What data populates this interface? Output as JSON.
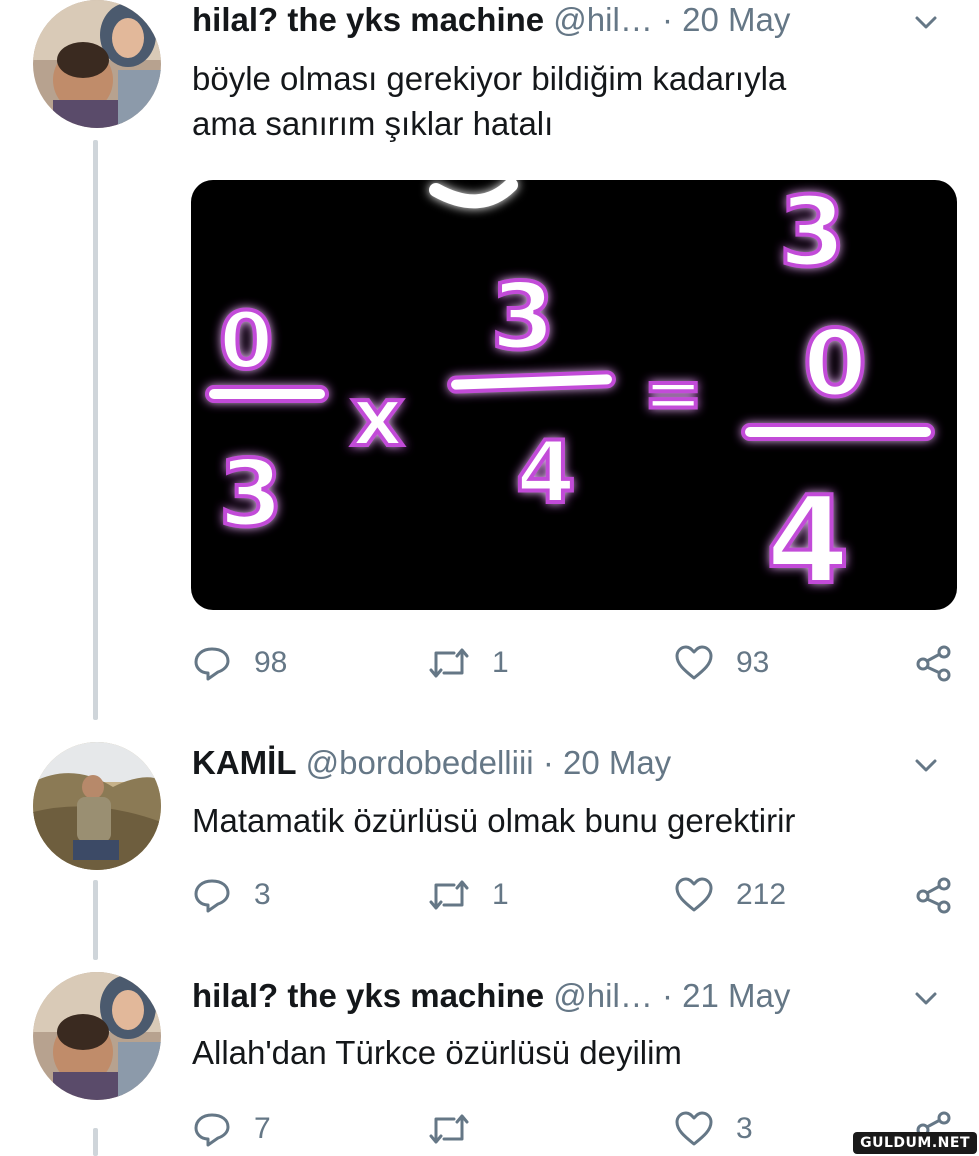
{
  "tweets": [
    {
      "display_name": "hilal? the yks machine",
      "handle": "@hil…",
      "date": "· 20 May",
      "text_lines": [
        "böyle olması gerekiyor bildiğim kadarıyla",
        "ama sanırım şıklar hatalı"
      ],
      "replies": "98",
      "retweets": "1",
      "likes": "93",
      "has_media": true
    },
    {
      "display_name": "KAMİL",
      "handle": "@bordobedelliii",
      "date": "· 20 May",
      "text_lines": [
        "Matamatik özürlüsü olmak bunu gerektirir"
      ],
      "replies": "3",
      "retweets": "1",
      "likes": "212",
      "has_media": false
    },
    {
      "display_name": "hilal? the yks machine",
      "handle": "@hil…",
      "date": "· 21 May",
      "text_lines": [
        "Allah'dan Türkce özürlüsü deyilim"
      ],
      "replies": "7",
      "retweets": "",
      "likes": "3",
      "has_media": false
    }
  ],
  "media": {
    "equation": {
      "lhs1_numerator": "0",
      "lhs1_denominator": "3",
      "operator": "x",
      "lhs2_numerator": "3",
      "lhs2_denominator": "4",
      "equals": "=",
      "rhs_numerator": "0",
      "rhs_denominator": "4",
      "top_digit": "3"
    }
  },
  "watermark": "GULDUM.NET",
  "colors": {
    "text": "#14171a",
    "secondary": "#657786",
    "thread_line": "#cfd5da",
    "media_bg": "#000000",
    "glow": "#c24bd8"
  },
  "icons": [
    "chevron-down-icon",
    "reply-icon",
    "retweet-icon",
    "like-icon",
    "share-icon"
  ]
}
